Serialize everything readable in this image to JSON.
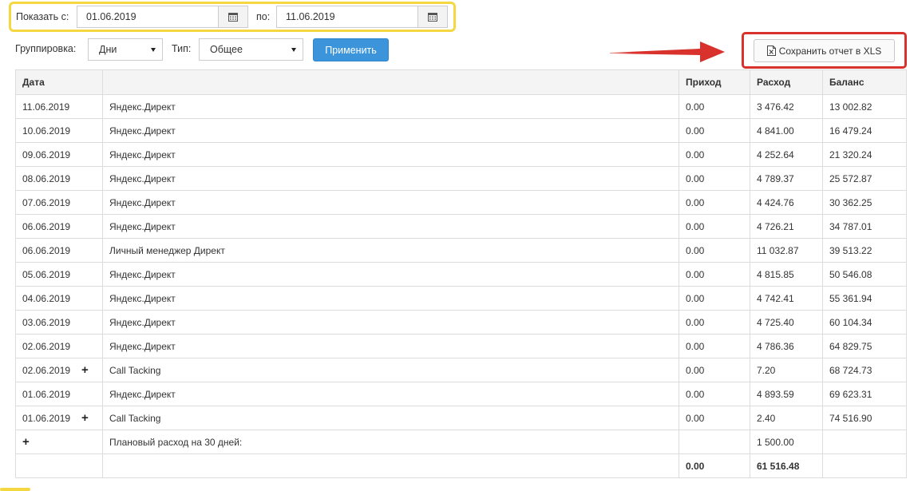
{
  "filters": {
    "from_label": "Показать с:",
    "from_value": "01.06.2019",
    "to_label": "по:",
    "to_value": "11.06.2019",
    "grouping_label": "Группировка:",
    "grouping_value": "Дни",
    "type_label": "Тип:",
    "type_value": "Общее",
    "apply_label": "Применить"
  },
  "export": {
    "save_label": "Сохранить отчет в XLS"
  },
  "colors": {
    "highlight_yellow": "#f5d742",
    "highlight_red": "#d9312b",
    "primary_button": "#3c95db"
  },
  "table": {
    "headers": {
      "date": "Дата",
      "description": "",
      "income": "Приход",
      "expense": "Расход",
      "balance": "Баланс"
    },
    "rows": [
      {
        "date": "11.06.2019",
        "description": "Яндекс.Директ",
        "income": "0.00",
        "expense": "3 476.42",
        "balance": "13 002.82"
      },
      {
        "date": "10.06.2019",
        "description": "Яндекс.Директ",
        "income": "0.00",
        "expense": "4 841.00",
        "balance": "16 479.24"
      },
      {
        "date": "09.06.2019",
        "description": "Яндекс.Директ",
        "income": "0.00",
        "expense": "4 252.64",
        "balance": "21 320.24"
      },
      {
        "date": "08.06.2019",
        "description": "Яндекс.Директ",
        "income": "0.00",
        "expense": "4 789.37",
        "balance": "25 572.87"
      },
      {
        "date": "07.06.2019",
        "description": "Яндекс.Директ",
        "income": "0.00",
        "expense": "4 424.76",
        "balance": "30 362.25"
      },
      {
        "date": "06.06.2019",
        "description": "Яндекс.Директ",
        "income": "0.00",
        "expense": "4 726.21",
        "balance": "34 787.01"
      },
      {
        "date": "06.06.2019",
        "description": "Личный менеджер Директ",
        "income": "0.00",
        "expense": "11 032.87",
        "balance": "39 513.22"
      },
      {
        "date": "05.06.2019",
        "description": "Яндекс.Директ",
        "income": "0.00",
        "expense": "4 815.85",
        "balance": "50 546.08"
      },
      {
        "date": "04.06.2019",
        "description": "Яндекс.Директ",
        "income": "0.00",
        "expense": "4 742.41",
        "balance": "55 361.94"
      },
      {
        "date": "03.06.2019",
        "description": "Яндекс.Директ",
        "income": "0.00",
        "expense": "4 725.40",
        "balance": "60 104.34"
      },
      {
        "date": "02.06.2019",
        "description": "Яндекс.Директ",
        "income": "0.00",
        "expense": "4 786.36",
        "balance": "64 829.75"
      },
      {
        "date": "02.06.2019",
        "expandable": true,
        "description": "Call Tacking",
        "income": "0.00",
        "expense": "7.20",
        "balance": "68 724.73"
      },
      {
        "date": "01.06.2019",
        "description": "Яндекс.Директ",
        "income": "0.00",
        "expense": "4 893.59",
        "balance": "69 623.31"
      },
      {
        "date": "01.06.2019",
        "expandable": true,
        "description": "Call Tacking",
        "income": "0.00",
        "expense": "2.40",
        "balance": "74 516.90"
      }
    ],
    "planned": {
      "label": "Плановый расход на 30 дней:",
      "expense": "1 500.00"
    },
    "totals": {
      "income": "0.00",
      "expense": "61 516.48"
    },
    "expand_symbol": "+"
  }
}
